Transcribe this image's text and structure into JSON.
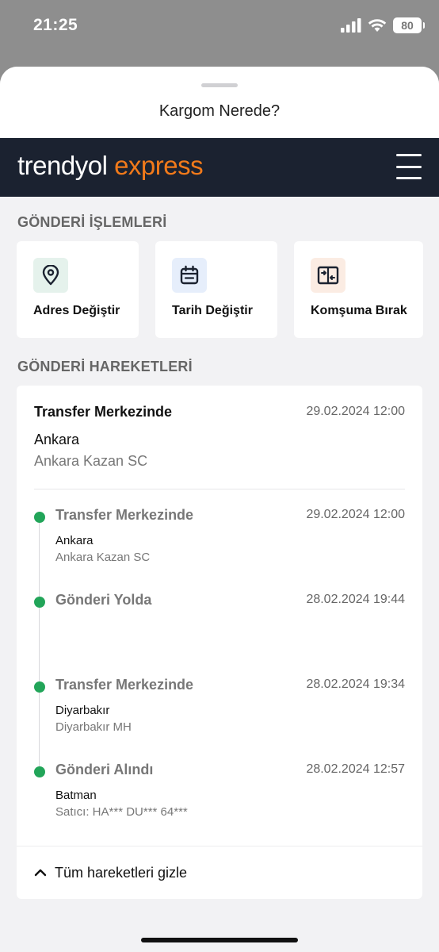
{
  "status_bar": {
    "time": "21:25",
    "battery": "80"
  },
  "sheet": {
    "title": "Kargom Nerede?"
  },
  "brand": {
    "logo_part1": "trendyol ",
    "logo_part2": "express"
  },
  "operations": {
    "section_title": "GÖNDERİ İŞLEMLERİ",
    "items": [
      {
        "label": "Adres Değiştir",
        "icon": "location-pin-icon"
      },
      {
        "label": "Tarih Değiştir",
        "icon": "calendar-icon"
      },
      {
        "label": "Komşuma Bırak",
        "icon": "exchange-icon"
      }
    ]
  },
  "movements": {
    "section_title": "GÖNDERİ HAREKETLERİ",
    "current": {
      "status": "Transfer Merkezinde",
      "date": "29.02.2024 12:00",
      "city": "Ankara",
      "branch": "Ankara Kazan SC"
    },
    "timeline": [
      {
        "status": "Transfer Merkezinde",
        "date": "29.02.2024 12:00",
        "city": "Ankara",
        "branch": "Ankara Kazan SC"
      },
      {
        "status": "Gönderi Yolda",
        "date": "28.02.2024 19:44",
        "city": "",
        "branch": ""
      },
      {
        "status": "Transfer Merkezinde",
        "date": "28.02.2024 19:34",
        "city": "Diyarbakır",
        "branch": "Diyarbakır MH"
      },
      {
        "status": "Gönderi Alındı",
        "date": "28.02.2024 12:57",
        "city": "Batman",
        "branch": "Satıcı: HA*** DU*** 64***"
      }
    ],
    "toggle_label": "Tüm hareketleri gizle"
  },
  "colors": {
    "brand_dark": "#1b2230",
    "brand_orange": "#f27a1a",
    "timeline_green": "#22a559"
  }
}
